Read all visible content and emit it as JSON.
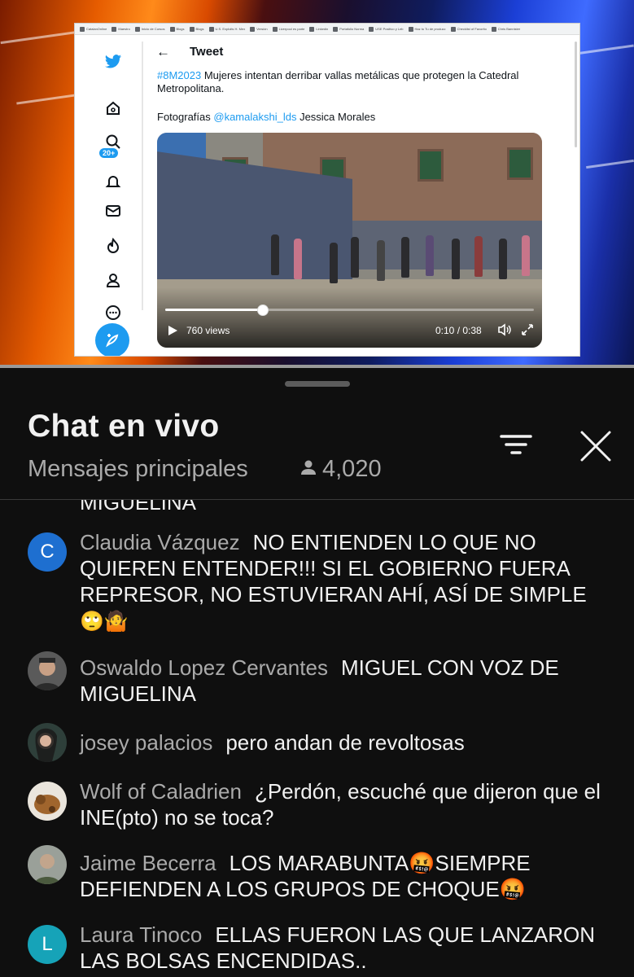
{
  "video": {
    "browser_bookmarks": [
      "CatalanOnline",
      "Maestro",
      "Inicio de Cursos",
      "Blogs",
      "Blogs",
      "U.S. Exploits H. Mex",
      "Versión",
      "Liverpool es parte",
      "Linkedin",
      "Portafolio Norma",
      "USE Positivo y Leb",
      "Haz tu Tu de producc",
      "Checklist of Favorito",
      "Chris Bannister"
    ],
    "twitter_nav": {
      "icons": [
        "twitter-logo-icon",
        "home-icon",
        "explore-icon",
        "notifications-icon",
        "messages-icon",
        "topics-icon",
        "profile-icon",
        "more-icon"
      ],
      "badge": "20+"
    },
    "tweet": {
      "back_icon": "←",
      "header": "Tweet",
      "hashtag": "#8M2023",
      "text": " Mujeres intentan derribar vallas metálicas que protegen la Catedral Metropolitana.",
      "credit_prefix": "Fotografías ",
      "credit_mention": "@kamalakshi_lds",
      "credit_suffix": " Jessica Morales",
      "media": {
        "views": "760 views",
        "time": "0:10 / 0:38",
        "progress": 0.263
      }
    },
    "progress": 1.0
  },
  "chat": {
    "title": "Chat en vivo",
    "mode": "Mensajes principales",
    "viewer_count": "4,020",
    "cut_off_text": "MIGUELINA",
    "messages": [
      {
        "author": "Claudia Vázquez",
        "text": "NO ENTIENDEN LO QUE NO QUIEREN ENTENDER!!! SI EL GOBIERNO FUERA REPRESOR, NO ESTUVIERAN AHÍ, ASÍ DE SIMPLE",
        "emoji": "🙄🤷",
        "avatar_letter": "C",
        "avatar_color": "#1e6fd0"
      },
      {
        "author": "Oswaldo Lopez Cervantes",
        "text": "MIGUEL CON VOZ DE MIGUELINA",
        "emoji": "",
        "avatar_letter": "",
        "avatar_color": "#6b6b6b"
      },
      {
        "author": "josey palacios",
        "text": "pero andan de revoltosas",
        "emoji": "",
        "avatar_letter": "",
        "avatar_color": "#3e5a4e"
      },
      {
        "author": "Wolf of Caladrien",
        "text": "¿Perdón, escuché que dijeron que el INE(pto) no se toca?",
        "emoji": "",
        "avatar_letter": "",
        "avatar_color": "#c9b9a2"
      },
      {
        "author": "Jaime Becerra",
        "text": "LOS MARABUNTA🤬SIEMPRE DEFIENDEN A LOS GRUPOS DE CHOQUE🤬",
        "emoji": "",
        "avatar_letter": "",
        "avatar_color": "#8a8f86"
      },
      {
        "author": "Laura Tinoco",
        "text": "ELLAS FUERON LAS QUE LANZARON LAS BOLSAS ENCENDIDAS..",
        "emoji": "",
        "avatar_letter": "L",
        "avatar_color": "#16a3b8"
      }
    ]
  }
}
